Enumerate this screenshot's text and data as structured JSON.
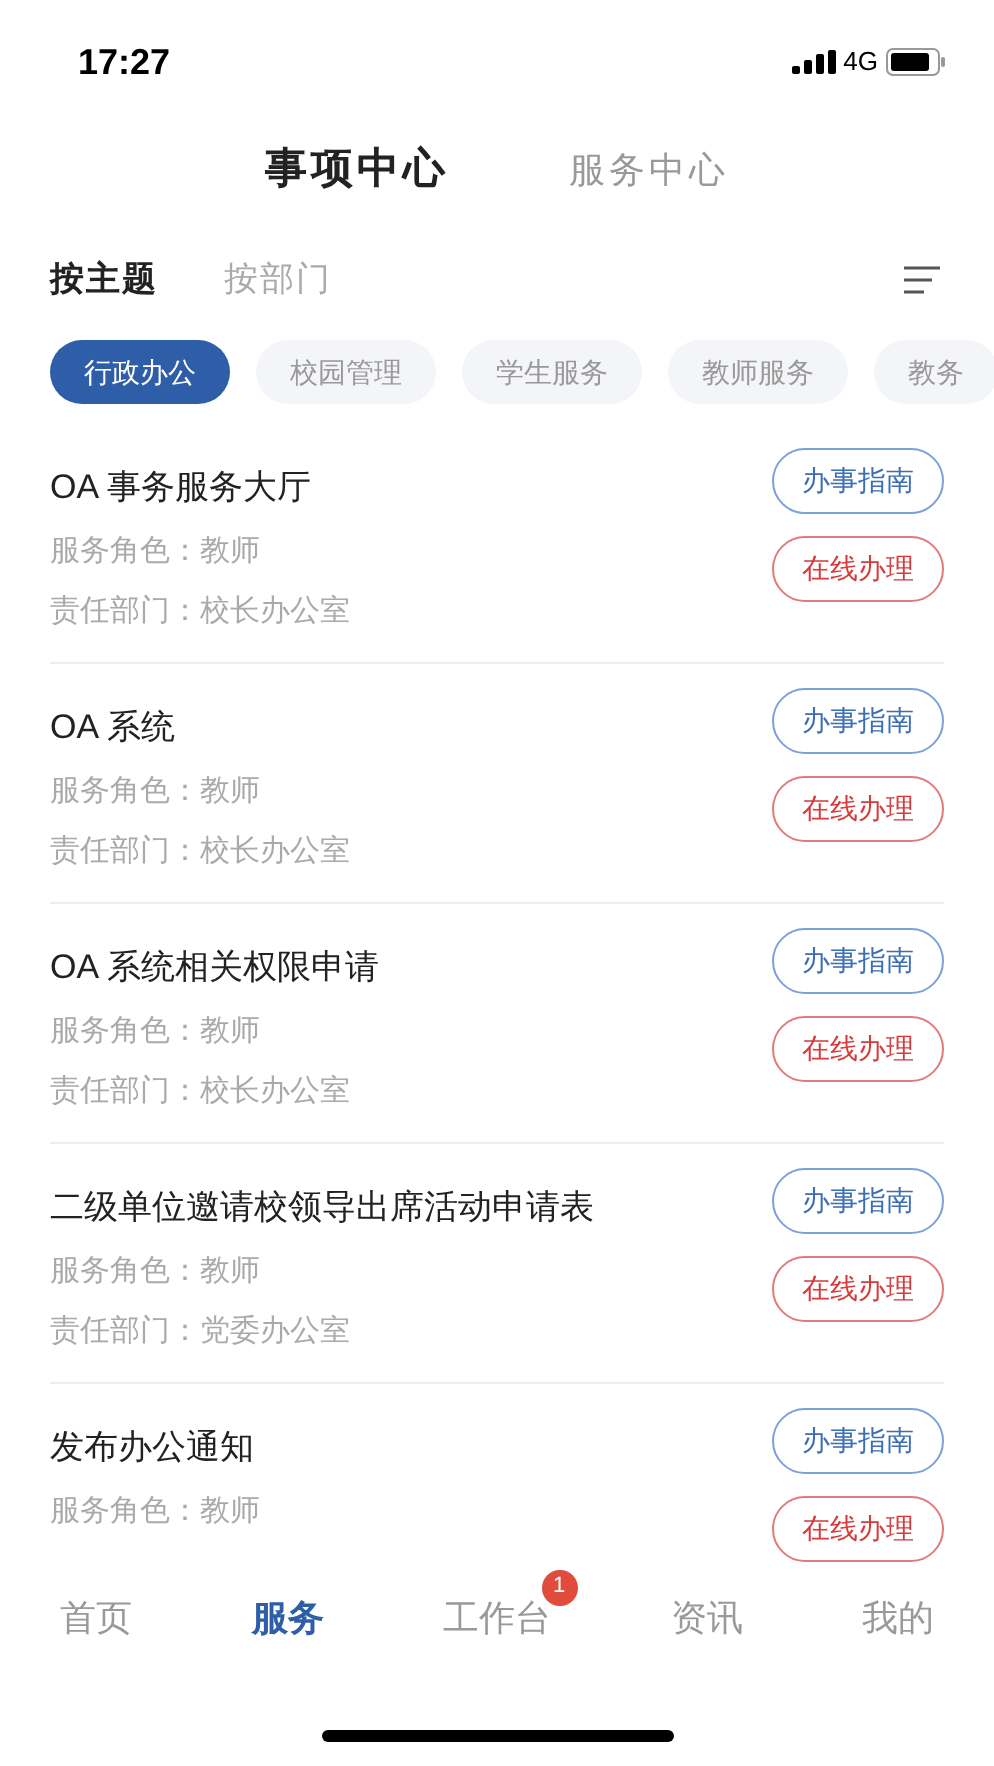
{
  "status_bar": {
    "time": "17:27",
    "network": "4G"
  },
  "header_tabs": [
    {
      "label": "事项中心",
      "selected": true
    },
    {
      "label": "服务中心",
      "selected": false
    }
  ],
  "sub_tabs": [
    {
      "label": "按主题",
      "selected": true
    },
    {
      "label": "按部门",
      "selected": false
    }
  ],
  "categories": [
    {
      "label": "行政办公",
      "selected": true
    },
    {
      "label": "校园管理",
      "selected": false
    },
    {
      "label": "学生服务",
      "selected": false
    },
    {
      "label": "教师服务",
      "selected": false
    },
    {
      "label": "教务",
      "selected": false
    }
  ],
  "items": [
    {
      "title": "OA 事务服务大厅",
      "role": "服务角色：教师",
      "department": "责任部门：校长办公室",
      "guide": "办事指南",
      "apply": "在线办理"
    },
    {
      "title": "OA 系统",
      "role": "服务角色：教师",
      "department": "责任部门：校长办公室",
      "guide": "办事指南",
      "apply": "在线办理"
    },
    {
      "title": "OA 系统相关权限申请",
      "role": "服务角色：教师",
      "department": "责任部门：校长办公室",
      "guide": "办事指南",
      "apply": "在线办理"
    },
    {
      "title": "二级单位邀请校领导出席活动申请表",
      "role": "服务角色：教师",
      "department": "责任部门：党委办公室",
      "guide": "办事指南",
      "apply": "在线办理"
    },
    {
      "title": "发布办公通知",
      "role": "服务角色：教师",
      "guide": "办事指南",
      "apply": "在线办理"
    }
  ],
  "bottom_nav": [
    {
      "label": "首页",
      "selected": false
    },
    {
      "label": "服务",
      "selected": true
    },
    {
      "label": "工作台",
      "selected": false,
      "badge": "1"
    },
    {
      "label": "资讯",
      "selected": false
    },
    {
      "label": "我的",
      "selected": false
    }
  ]
}
